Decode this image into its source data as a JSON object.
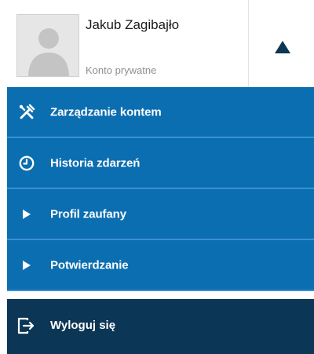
{
  "user": {
    "name": "Jakub Zagibajło",
    "account_type": "Konto prywatne"
  },
  "menu": {
    "items": [
      {
        "label": "Zarządzanie kontem",
        "icon": "tools-icon"
      },
      {
        "label": "Historia zdarzeń",
        "icon": "clock-icon"
      },
      {
        "label": "Profil zaufany",
        "icon": "play-arrow-icon"
      },
      {
        "label": "Potwierdzanie",
        "icon": "play-arrow-icon"
      }
    ],
    "logout_label": "Wyloguj się",
    "logout_icon": "logout-icon"
  },
  "colors": {
    "menu_bg": "#0b6eb0",
    "menu_separator": "#3b8fd0",
    "logout_bg": "#0c3655",
    "toggle_arrow": "#0c3655"
  }
}
